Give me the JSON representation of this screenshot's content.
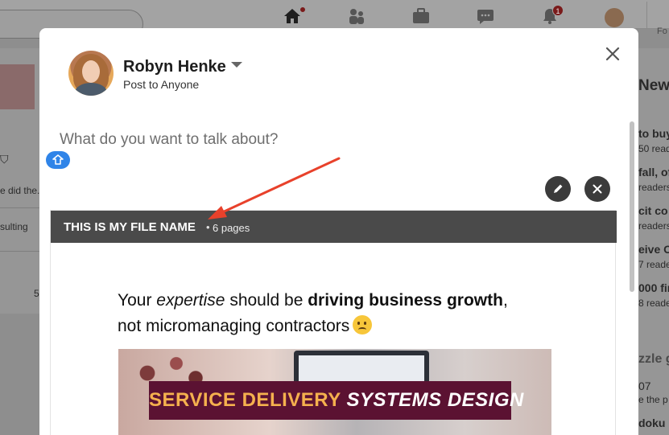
{
  "modal": {
    "user_name": "Robyn Henke",
    "post_visibility": "Post to Anyone",
    "prompt_placeholder": "What do you want to talk about?",
    "document": {
      "title": "THIS IS MY FILE NAME",
      "separator": "•",
      "pages": "6 pages",
      "slide": {
        "line1_part1": "Your ",
        "line1_italic": "expertise",
        "line1_part2": " should be ",
        "line1_bold": "driving business growth",
        "line1_part3": ",",
        "line2": "not micromanaging contractors",
        "banner_part1": "SERVICE DELIVERY ",
        "banner_part2": "SYSTEMS DESIGN"
      }
    }
  },
  "navbar": {
    "home_badge": "",
    "notifications_badge": "1",
    "for_text": "Fo"
  },
  "background_left": {
    "line1": "e did the.",
    "line2": "sulting",
    "count": "5"
  },
  "background_right": {
    "heading": "News",
    "items": [
      {
        "title": "to buy",
        "sub": "50 read"
      },
      {
        "title": "fall, of",
        "sub": "readers"
      },
      {
        "title": "cit co",
        "sub": "readers"
      },
      {
        "title": "eive O",
        "sub": "7 reade"
      },
      {
        "title": "000 fir",
        "sub": "8 reade"
      },
      {
        "title": "zzle g",
        "sub": ""
      },
      {
        "title": "07",
        "sub": "e the p"
      },
      {
        "title": "doku",
        "sub": ""
      }
    ]
  },
  "colors": {
    "accent_blue": "#2f84e8",
    "arrow_red": "#e8412b",
    "doc_header": "#4a4a4a",
    "banner_bg": "#5b1232",
    "banner_text": "#f5b14e"
  }
}
